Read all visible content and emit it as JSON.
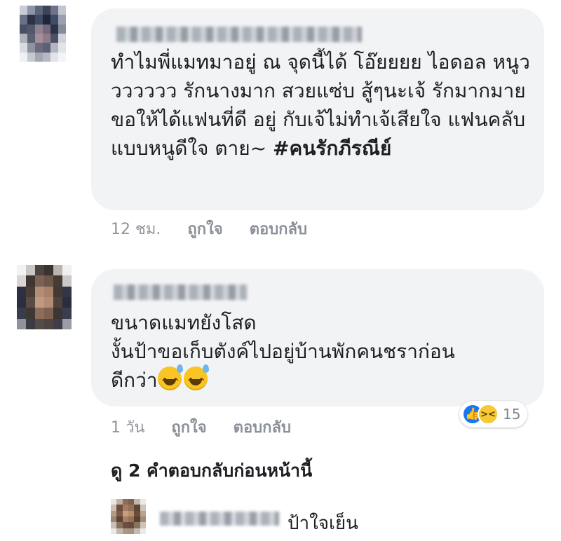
{
  "comments": [
    {
      "text": "ทำไมพี่แมทมาอยู่ ณ จุดนี้ได้ โอ๊ยยยย ไอดอล หนูววววววว รักนางมาก สวยแซ่บ สู้ๆนะเจ้ รักมากมาย ขอให้ได้แฟนที่ดี อยู่ กับเจ้ไม่ทำเจ้เสียใจ แฟนคลับแบบหนูดีใจ ตาย~ ",
      "hashtag": "#คนรักภีรณีย์",
      "time": "12 ชม.",
      "like_label": "ถูกใจ",
      "reply_label": "ตอบกลับ"
    },
    {
      "text": "ขนาดแมทยังโสด\nงั้นป้าขอเก็บตังค์ไปอยู่บ้านพักคนชราก่อน\nดีกว่า",
      "time": "1 วัน",
      "like_label": "ถูกใจ",
      "reply_label": "ตอบกลับ",
      "reaction_count": "15",
      "reaction_icons": [
        "like-icon",
        "haha-icon"
      ]
    }
  ],
  "view_more": "ดู 2 คำตอบกลับก่อนหน้านี้",
  "reply": {
    "text": "ป้าใจเย็น"
  },
  "colors": {
    "bubble": "#f2f3f5",
    "meta": "#90949c",
    "like_blue": "#1877f2",
    "haha_yellow": "#f7c934"
  }
}
